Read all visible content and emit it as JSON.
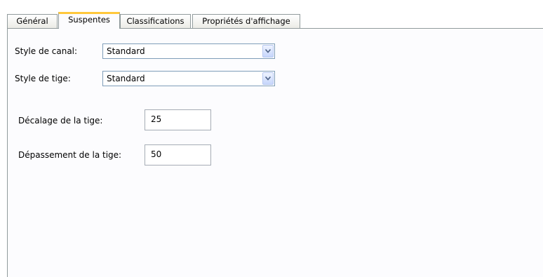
{
  "tabs": [
    {
      "label": "Général",
      "active": false
    },
    {
      "label": "Suspentes",
      "active": true
    },
    {
      "label": "Classifications",
      "active": false
    },
    {
      "label": "Propriétés d'affichage",
      "active": false
    }
  ],
  "form": {
    "channel_style": {
      "label": "Style de canal:",
      "value": "Standard"
    },
    "rod_style": {
      "label": "Style de tige:",
      "value": "Standard"
    },
    "rod_offset": {
      "label": "Décalage de la tige:",
      "value": "25"
    },
    "rod_extension": {
      "label": "Dépassement de la tige:",
      "value": "50"
    }
  },
  "icons": {
    "dropdown_arrow": "chevron-down-icon"
  },
  "colors": {
    "active_tab_accent": "#ffc83c",
    "tab_border": "#919b9c",
    "input_border": "#7f9db9"
  }
}
